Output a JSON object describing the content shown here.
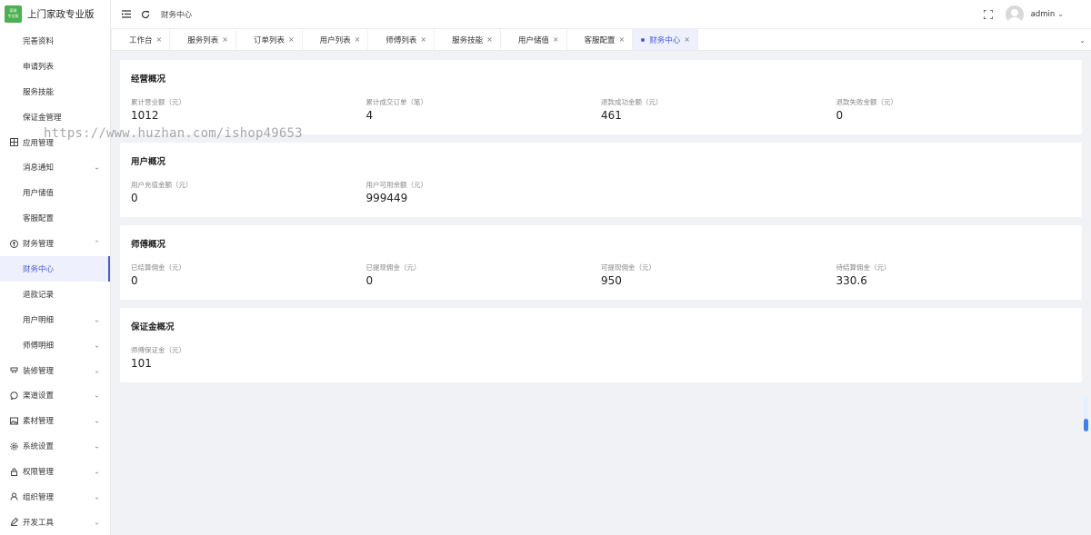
{
  "app": {
    "logo_line1": "家政",
    "logo_line2": "专业版",
    "title": "上门家政专业版"
  },
  "sidebar": {
    "items": [
      {
        "label": "完善资料",
        "level": "sub"
      },
      {
        "label": "申请列表",
        "level": "sub"
      },
      {
        "label": "服务技能",
        "level": "sub"
      },
      {
        "label": "保证金管理",
        "level": "sub"
      },
      {
        "label": "应用管理",
        "level": "top",
        "icon": "grid-icon"
      },
      {
        "label": "消息通知",
        "level": "sub",
        "expandable": true
      },
      {
        "label": "用户储值",
        "level": "sub"
      },
      {
        "label": "客服配置",
        "level": "sub"
      },
      {
        "label": "财务管理",
        "level": "top",
        "icon": "finance-icon",
        "expanded": true
      },
      {
        "label": "财务中心",
        "level": "sub",
        "active": true
      },
      {
        "label": "退款记录",
        "level": "sub"
      },
      {
        "label": "用户明细",
        "level": "sub",
        "expandable": true
      },
      {
        "label": "师傅明细",
        "level": "sub",
        "expandable": true
      },
      {
        "label": "装修管理",
        "level": "top",
        "icon": "decorate-icon",
        "expandable": true
      },
      {
        "label": "渠道设置",
        "level": "top",
        "icon": "chat-icon",
        "expandable": true
      },
      {
        "label": "素材管理",
        "level": "top",
        "icon": "image-icon",
        "expandable": true
      },
      {
        "label": "系统设置",
        "level": "top",
        "icon": "gear-icon",
        "expandable": true
      },
      {
        "label": "权限管理",
        "level": "top",
        "icon": "lock-icon",
        "expandable": true
      },
      {
        "label": "组织管理",
        "level": "top",
        "icon": "user-icon",
        "expandable": true
      },
      {
        "label": "开发工具",
        "level": "top",
        "icon": "pen-icon",
        "expandable": true
      }
    ]
  },
  "header": {
    "breadcrumb": "财务中心",
    "username": "admin"
  },
  "tabs": [
    {
      "label": "工作台"
    },
    {
      "label": "服务列表"
    },
    {
      "label": "订单列表"
    },
    {
      "label": "用户列表"
    },
    {
      "label": "师傅列表"
    },
    {
      "label": "服务技能"
    },
    {
      "label": "用户储值"
    },
    {
      "label": "客服配置"
    },
    {
      "label": "财务中心",
      "active": true
    }
  ],
  "sections": [
    {
      "title": "经营概况",
      "stats": [
        {
          "label": "累计营业额（元）",
          "value": "1012"
        },
        {
          "label": "累计成交订单（笔）",
          "value": "4"
        },
        {
          "label": "退款成功金额（元）",
          "value": "461"
        },
        {
          "label": "退款失败金额（元）",
          "value": "0"
        }
      ]
    },
    {
      "title": "用户概况",
      "stats": [
        {
          "label": "用户充值金额（元）",
          "value": "0"
        },
        {
          "label": "用户可用余额（元）",
          "value": "999449"
        }
      ]
    },
    {
      "title": "师傅概况",
      "stats": [
        {
          "label": "已结算佣金（元）",
          "value": "0"
        },
        {
          "label": "已提现佣金（元）",
          "value": "0"
        },
        {
          "label": "可提现佣金（元）",
          "value": "950"
        },
        {
          "label": "待结算佣金（元）",
          "value": "330.6"
        }
      ]
    },
    {
      "title": "保证金概况",
      "stats": [
        {
          "label": "师傅保证金（元）",
          "value": "101"
        }
      ]
    }
  ],
  "watermark": "https://www.huzhan.com/ishop49653",
  "colors": {
    "accent": "#4a5bdc",
    "active_bg": "#eef0fd",
    "main_bg": "#f0f2f5",
    "logo_bg": "#4caf50"
  }
}
